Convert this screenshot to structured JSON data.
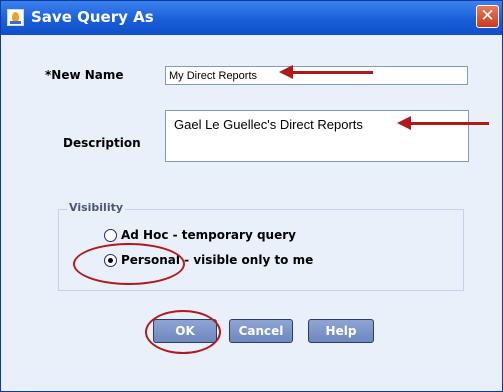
{
  "dialog": {
    "title": "Save Query As"
  },
  "form": {
    "new_name_label": "*New Name",
    "new_name_value": "My Direct Reports",
    "description_label": "Description",
    "description_value": "Gael Le Guellec's Direct Reports"
  },
  "visibility": {
    "title": "Visibility",
    "options": [
      {
        "label": "Ad Hoc - temporary query",
        "selected": false
      },
      {
        "label": "Personal - visible only to me",
        "selected": true
      }
    ]
  },
  "buttons": {
    "ok": "OK",
    "cancel": "Cancel",
    "help": "Help"
  },
  "annotations": {
    "color": "#b11818"
  }
}
